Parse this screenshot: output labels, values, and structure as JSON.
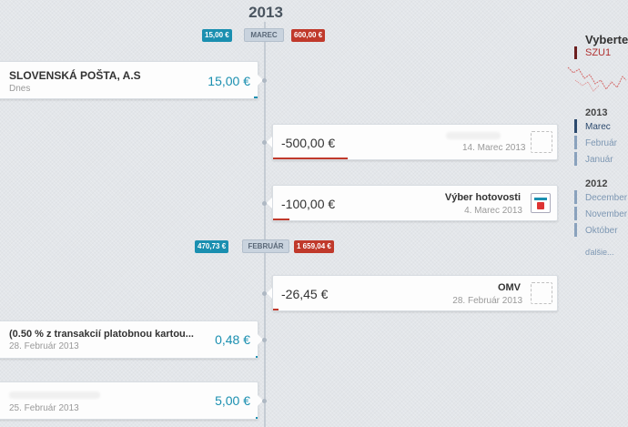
{
  "timeline": {
    "year": "2013",
    "months": [
      {
        "income": "15,00 €",
        "label": "MAREC",
        "expense": "600,00 €"
      },
      {
        "income": "470,73 €",
        "label": "FEBRUÁR",
        "expense": "1 659,04 €"
      }
    ]
  },
  "transactions": [
    {
      "title": "SLOVENSKÁ POŠTA, A.S",
      "date": "Dnes",
      "amount": "15,00 €",
      "kind": "income"
    },
    {
      "title": "",
      "date": "14. Marec 2013",
      "amount": "-500,00 €",
      "kind": "expense"
    },
    {
      "title": "Výber hotovosti",
      "date": "4. Marec 2013",
      "amount": "-100,00 €",
      "kind": "expense"
    },
    {
      "title": "OMV",
      "date": "28. Február 2013",
      "amount": "-26,45 €",
      "kind": "expense"
    },
    {
      "title": "(0.50 % z transakcií platobnou kartou...",
      "date": "28. Február 2013",
      "amount": "0,48 €",
      "kind": "income"
    },
    {
      "title": "",
      "date": "25. Február 2013",
      "amount": "5,00 €",
      "kind": "income"
    }
  ],
  "sidebar": {
    "heading": "Vyberte",
    "account": "SZU1",
    "years": [
      {
        "year": "2013",
        "months": [
          "Marec",
          "Február",
          "Január"
        ]
      },
      {
        "year": "2012",
        "months": [
          "December",
          "November",
          "Október"
        ]
      }
    ],
    "more": "ďalšie..."
  },
  "colors": {
    "income": "#1a8fb0",
    "expense": "#c0392b",
    "background": "#e3e6ea"
  }
}
